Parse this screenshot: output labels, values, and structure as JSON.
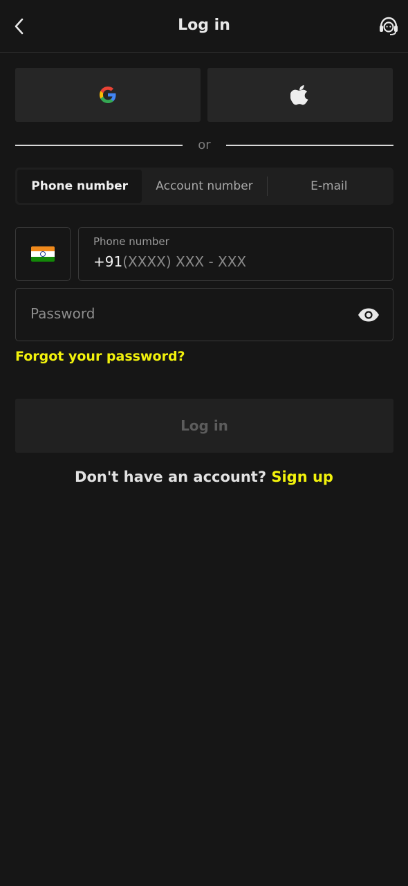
{
  "header": {
    "title": "Log in",
    "back_icon": "chevron-left-icon",
    "support_icon": "headset-support-icon"
  },
  "social": {
    "google_icon": "google-icon",
    "apple_icon": "apple-icon"
  },
  "divider": {
    "text": "or"
  },
  "tabs": [
    {
      "label": "Phone number",
      "active": true
    },
    {
      "label": "Account number",
      "active": false
    },
    {
      "label": "E-mail",
      "active": false
    }
  ],
  "phone": {
    "country_flag": "india-flag-icon",
    "label": "Phone number",
    "prefix": "+91",
    "mask": "(XXXX) XXX - XXX"
  },
  "password": {
    "placeholder": "Password",
    "toggle_icon": "eye-icon"
  },
  "forgot_label": "Forgot your password?",
  "login_label": "Log in",
  "signup": {
    "question": "Don't have an account?",
    "link": "Sign up"
  },
  "colors": {
    "background": "#161616",
    "accent": "#f2f20c",
    "panel": "#262626"
  }
}
